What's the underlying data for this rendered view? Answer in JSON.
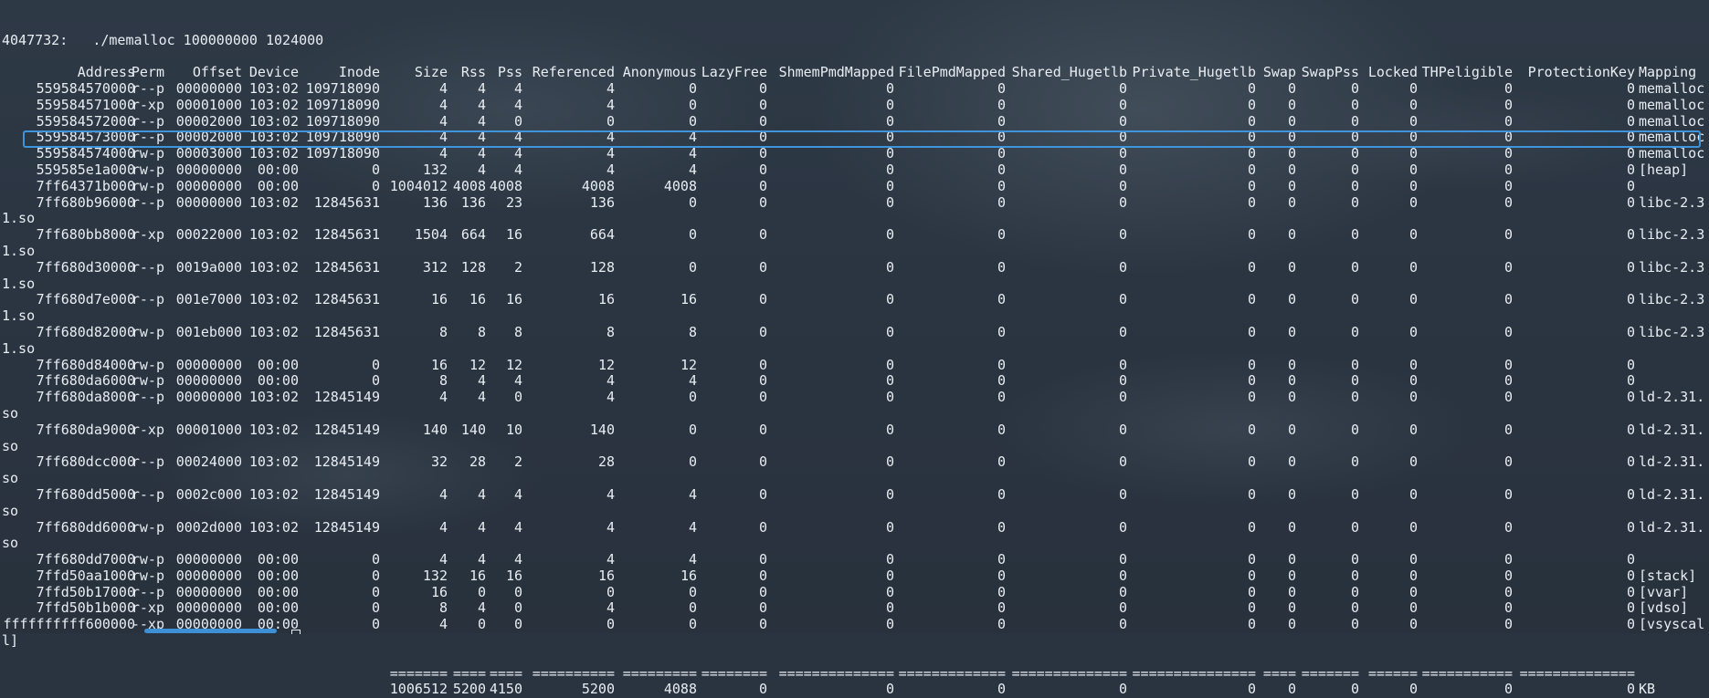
{
  "command": "4047732:   ./memalloc 100000000 1024000",
  "headers": [
    "Address",
    "Perm",
    "Offset",
    "Device",
    "Inode",
    "Size",
    "Rss",
    "Pss",
    "Referenced",
    "Anonymous",
    "LazyFree",
    "ShmemPmdMapped",
    "FilePmdMapped",
    "Shared_Hugetlb",
    "Private_Hugetlb",
    "Swap",
    "SwapPss",
    "Locked",
    "THPeligible",
    "ProtectionKey",
    "Mapping"
  ],
  "rows": [
    {
      "v": [
        "559584570000",
        "r--p",
        "00000000",
        "103:02",
        "109718090",
        "4",
        "4",
        "4",
        "4",
        "0",
        "0",
        "0",
        "0",
        "0",
        "0",
        "0",
        "0",
        "0",
        "0",
        "0",
        "memalloc"
      ]
    },
    {
      "v": [
        "559584571000",
        "r-xp",
        "00001000",
        "103:02",
        "109718090",
        "4",
        "4",
        "4",
        "4",
        "0",
        "0",
        "0",
        "0",
        "0",
        "0",
        "0",
        "0",
        "0",
        "0",
        "0",
        "memalloc"
      ]
    },
    {
      "v": [
        "559584572000",
        "r--p",
        "00002000",
        "103:02",
        "109718090",
        "4",
        "4",
        "0",
        "0",
        "0",
        "0",
        "0",
        "0",
        "0",
        "0",
        "0",
        "0",
        "0",
        "0",
        "0",
        "memalloc"
      ]
    },
    {
      "v": [
        "559584573000",
        "r--p",
        "00002000",
        "103:02",
        "109718090",
        "4",
        "4",
        "4",
        "4",
        "4",
        "0",
        "0",
        "0",
        "0",
        "0",
        "0",
        "0",
        "0",
        "0",
        "0",
        "memalloc"
      ]
    },
    {
      "v": [
        "559584574000",
        "rw-p",
        "00003000",
        "103:02",
        "109718090",
        "4",
        "4",
        "4",
        "4",
        "4",
        "0",
        "0",
        "0",
        "0",
        "0",
        "0",
        "0",
        "0",
        "0",
        "0",
        "memalloc"
      ]
    },
    {
      "v": [
        "559585e1a000",
        "rw-p",
        "00000000",
        "00:00",
        "0",
        "132",
        "4",
        "4",
        "4",
        "4",
        "0",
        "0",
        "0",
        "0",
        "0",
        "0",
        "0",
        "0",
        "0",
        "0",
        "[heap]"
      ]
    },
    {
      "v": [
        "7ff64371b000",
        "rw-p",
        "00000000",
        "00:00",
        "0",
        "1004012",
        "4008",
        "4008",
        "4008",
        "4008",
        "0",
        "0",
        "0",
        "0",
        "0",
        "0",
        "0",
        "0",
        "0",
        "0",
        ""
      ],
      "highlight": true
    },
    {
      "v": [
        "7ff680b96000",
        "r--p",
        "00000000",
        "103:02",
        "12845631",
        "136",
        "136",
        "23",
        "136",
        "0",
        "0",
        "0",
        "0",
        "0",
        "0",
        "0",
        "0",
        "0",
        "0",
        "0",
        "libc-2.3"
      ],
      "wrap": "1.so"
    },
    {
      "v": [
        "7ff680bb8000",
        "r-xp",
        "00022000",
        "103:02",
        "12845631",
        "1504",
        "664",
        "16",
        "664",
        "0",
        "0",
        "0",
        "0",
        "0",
        "0",
        "0",
        "0",
        "0",
        "0",
        "0",
        "libc-2.3"
      ],
      "wrap": "1.so"
    },
    {
      "v": [
        "7ff680d30000",
        "r--p",
        "0019a000",
        "103:02",
        "12845631",
        "312",
        "128",
        "2",
        "128",
        "0",
        "0",
        "0",
        "0",
        "0",
        "0",
        "0",
        "0",
        "0",
        "0",
        "0",
        "libc-2.3"
      ],
      "wrap": "1.so"
    },
    {
      "v": [
        "7ff680d7e000",
        "r--p",
        "001e7000",
        "103:02",
        "12845631",
        "16",
        "16",
        "16",
        "16",
        "16",
        "0",
        "0",
        "0",
        "0",
        "0",
        "0",
        "0",
        "0",
        "0",
        "0",
        "libc-2.3"
      ],
      "wrap": "1.so"
    },
    {
      "v": [
        "7ff680d82000",
        "rw-p",
        "001eb000",
        "103:02",
        "12845631",
        "8",
        "8",
        "8",
        "8",
        "8",
        "0",
        "0",
        "0",
        "0",
        "0",
        "0",
        "0",
        "0",
        "0",
        "0",
        "libc-2.3"
      ],
      "wrap": "1.so"
    },
    {
      "v": [
        "7ff680d84000",
        "rw-p",
        "00000000",
        "00:00",
        "0",
        "16",
        "12",
        "12",
        "12",
        "12",
        "0",
        "0",
        "0",
        "0",
        "0",
        "0",
        "0",
        "0",
        "0",
        "0",
        ""
      ]
    },
    {
      "v": [
        "7ff680da6000",
        "rw-p",
        "00000000",
        "00:00",
        "0",
        "8",
        "4",
        "4",
        "4",
        "4",
        "0",
        "0",
        "0",
        "0",
        "0",
        "0",
        "0",
        "0",
        "0",
        "0",
        ""
      ]
    },
    {
      "v": [
        "7ff680da8000",
        "r--p",
        "00000000",
        "103:02",
        "12845149",
        "4",
        "4",
        "0",
        "4",
        "0",
        "0",
        "0",
        "0",
        "0",
        "0",
        "0",
        "0",
        "0",
        "0",
        "0",
        "ld-2.31."
      ],
      "wrap": "so"
    },
    {
      "v": [
        "7ff680da9000",
        "r-xp",
        "00001000",
        "103:02",
        "12845149",
        "140",
        "140",
        "10",
        "140",
        "0",
        "0",
        "0",
        "0",
        "0",
        "0",
        "0",
        "0",
        "0",
        "0",
        "0",
        "ld-2.31."
      ],
      "wrap": "so"
    },
    {
      "v": [
        "7ff680dcc000",
        "r--p",
        "00024000",
        "103:02",
        "12845149",
        "32",
        "28",
        "2",
        "28",
        "0",
        "0",
        "0",
        "0",
        "0",
        "0",
        "0",
        "0",
        "0",
        "0",
        "0",
        "ld-2.31."
      ],
      "wrap": "so"
    },
    {
      "v": [
        "7ff680dd5000",
        "r--p",
        "0002c000",
        "103:02",
        "12845149",
        "4",
        "4",
        "4",
        "4",
        "4",
        "0",
        "0",
        "0",
        "0",
        "0",
        "0",
        "0",
        "0",
        "0",
        "0",
        "ld-2.31."
      ],
      "wrap": "so"
    },
    {
      "v": [
        "7ff680dd6000",
        "rw-p",
        "0002d000",
        "103:02",
        "12845149",
        "4",
        "4",
        "4",
        "4",
        "4",
        "0",
        "0",
        "0",
        "0",
        "0",
        "0",
        "0",
        "0",
        "0",
        "0",
        "ld-2.31."
      ],
      "wrap": "so"
    },
    {
      "v": [
        "7ff680dd7000",
        "rw-p",
        "00000000",
        "00:00",
        "0",
        "4",
        "4",
        "4",
        "4",
        "4",
        "0",
        "0",
        "0",
        "0",
        "0",
        "0",
        "0",
        "0",
        "0",
        "0",
        ""
      ]
    },
    {
      "v": [
        "7ffd50aa1000",
        "rw-p",
        "00000000",
        "00:00",
        "0",
        "132",
        "16",
        "16",
        "16",
        "16",
        "0",
        "0",
        "0",
        "0",
        "0",
        "0",
        "0",
        "0",
        "0",
        "0",
        "[stack]"
      ]
    },
    {
      "v": [
        "7ffd50b17000",
        "r--p",
        "00000000",
        "00:00",
        "0",
        "16",
        "0",
        "0",
        "0",
        "0",
        "0",
        "0",
        "0",
        "0",
        "0",
        "0",
        "0",
        "0",
        "0",
        "0",
        "[vvar]"
      ]
    },
    {
      "v": [
        "7ffd50b1b000",
        "r-xp",
        "00000000",
        "00:00",
        "0",
        "8",
        "4",
        "0",
        "4",
        "0",
        "0",
        "0",
        "0",
        "0",
        "0",
        "0",
        "0",
        "0",
        "0",
        "0",
        "[vdso]"
      ]
    },
    {
      "v": [
        "ffffffffff600000",
        "--xp",
        "00000000",
        "00:00",
        "0",
        "4",
        "0",
        "0",
        "0",
        "0",
        "0",
        "0",
        "0",
        "0",
        "0",
        "0",
        "0",
        "0",
        "0",
        "0",
        "[vsyscal"
      ],
      "wrap": "l]"
    }
  ],
  "separator": [
    "",
    "",
    "",
    "",
    "",
    "=======",
    "====",
    "====",
    "==========",
    "=========",
    "========",
    "==============",
    "=============",
    "==============",
    "===============",
    "====",
    "=======",
    "======",
    "===========",
    "==============",
    ""
  ],
  "totals": [
    "",
    "",
    "",
    "",
    "",
    "1006512",
    "5200",
    "4150",
    "5200",
    "4088",
    "0",
    "0",
    "0",
    "0",
    "0",
    "0",
    "0",
    "0",
    "0",
    "0",
    "KB"
  ],
  "colors": {
    "text": "#e8edf2",
    "highlight_border": "#3e95dc",
    "background": "#2a3440"
  },
  "taskbar": {
    "progress_fraction": 1.0
  }
}
